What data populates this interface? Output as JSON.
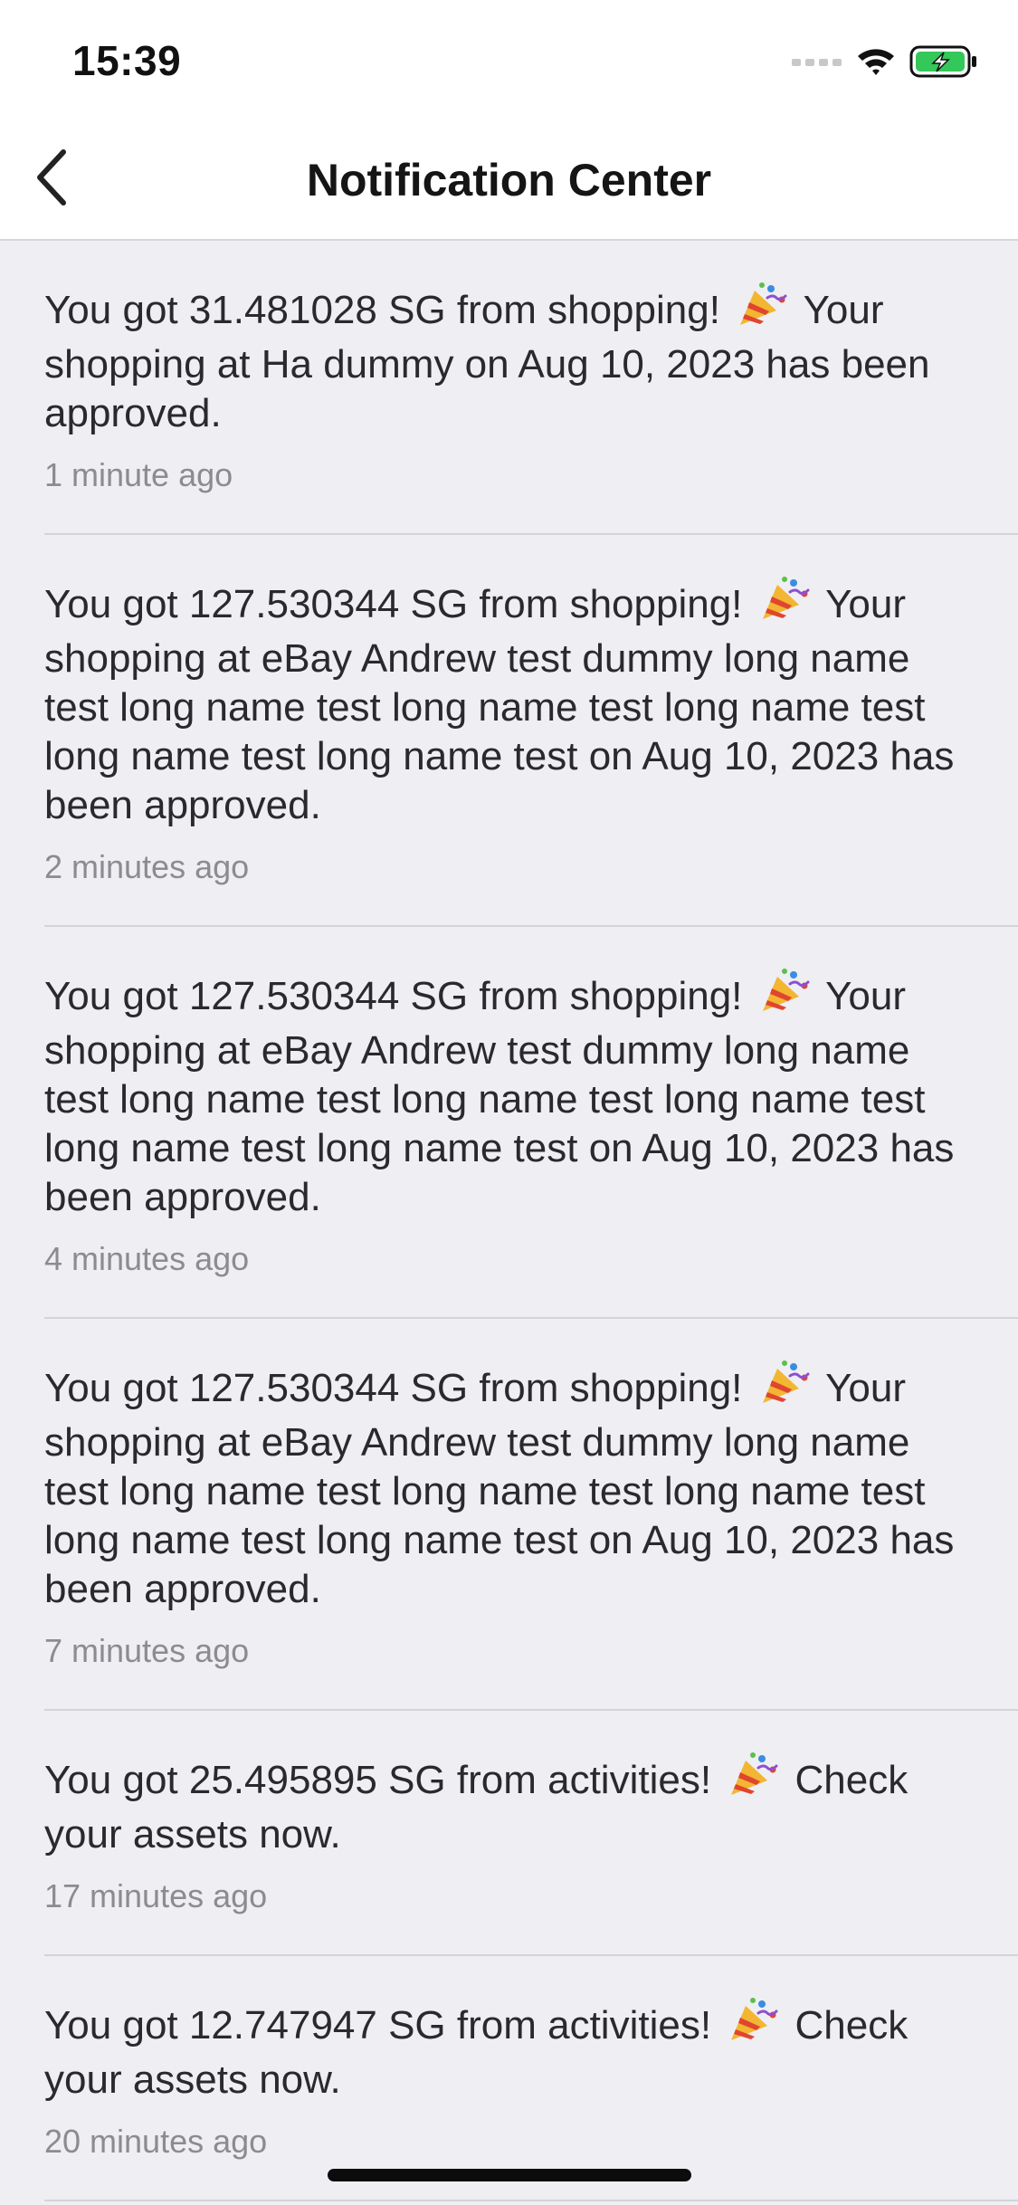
{
  "status_bar": {
    "time": "15:39"
  },
  "nav": {
    "title": "Notification Center"
  },
  "notifications": [
    {
      "before": "You got 31.481028 SG from shopping!",
      "after": "Your shopping at Ha dummy on Aug 10, 2023 has been approved.",
      "time": "1 minute ago"
    },
    {
      "before": "You got 127.530344 SG from shopping!",
      "after": "Your shopping at eBay Andrew test dummy long name test long name test long name test long name test long name test long name test on Aug 10, 2023 has been approved.",
      "time": "2 minutes ago"
    },
    {
      "before": "You got 127.530344 SG from shopping!",
      "after": "Your shopping at eBay Andrew test dummy long name test long name test long name test long name test long name test long name test on Aug 10, 2023 has been approved.",
      "time": "4 minutes ago"
    },
    {
      "before": "You got 127.530344 SG from shopping!",
      "after": "Your shopping at eBay Andrew test dummy long name test long name test long name test long name test long name test long name test on Aug 10, 2023 has been approved.",
      "time": "7 minutes ago"
    },
    {
      "before": "You got 25.495895 SG from activities!",
      "after": "Check your assets now.",
      "time": "17 minutes ago"
    },
    {
      "before": "You got 12.747947 SG from activities!",
      "after": "Check your assets now.",
      "time": "20 minutes ago"
    }
  ],
  "colors": {
    "background": "#eeeef3",
    "bar": "#ffffff",
    "battery": "#34c759",
    "secondary_text": "#8c8c90"
  },
  "icons": {
    "back": "chevron-left-icon",
    "celebration": "party-popper-icon",
    "signal": "cellular-signal-icon",
    "wifi": "wifi-icon",
    "battery": "battery-charging-icon"
  }
}
